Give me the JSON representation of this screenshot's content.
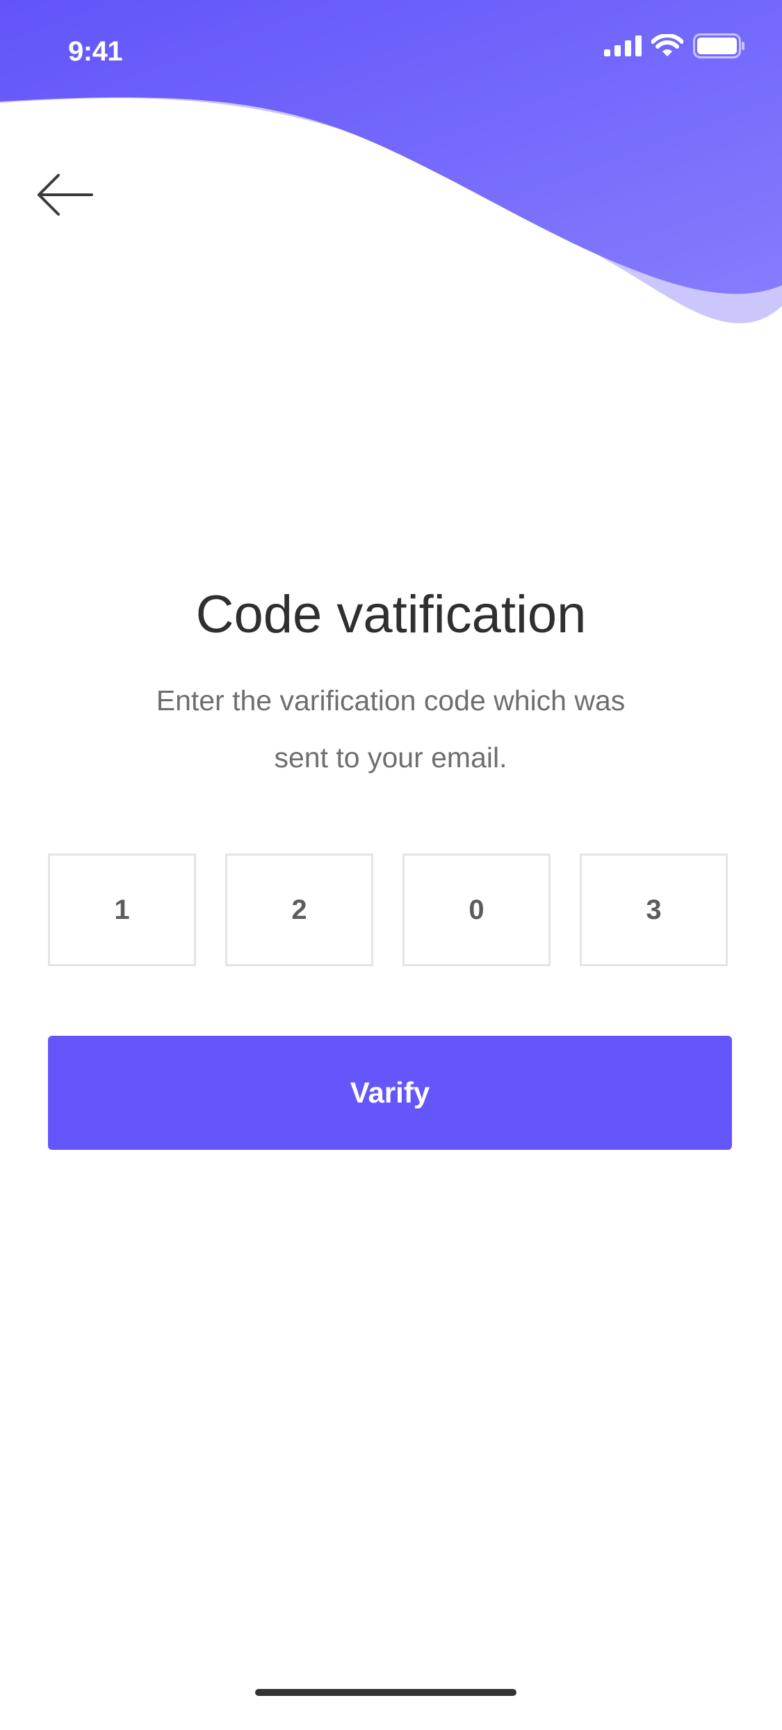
{
  "status_bar": {
    "time": "9:41"
  },
  "colors": {
    "accent": "#6556FB",
    "wave_light": "#CBC7FD",
    "title": "#2F2F2F",
    "subtitle": "#6E6E6E"
  },
  "icons": {
    "back": "arrow-left-icon",
    "signal": "cellular-signal-icon",
    "wifi": "wifi-icon",
    "battery": "battery-icon"
  },
  "main": {
    "title": "Code vatification",
    "subtitle_line1": "Enter the varification code which was",
    "subtitle_line2": "sent to your email.",
    "code_digits": [
      "1",
      "2",
      "0",
      "3"
    ],
    "verify_label": "Varify"
  }
}
